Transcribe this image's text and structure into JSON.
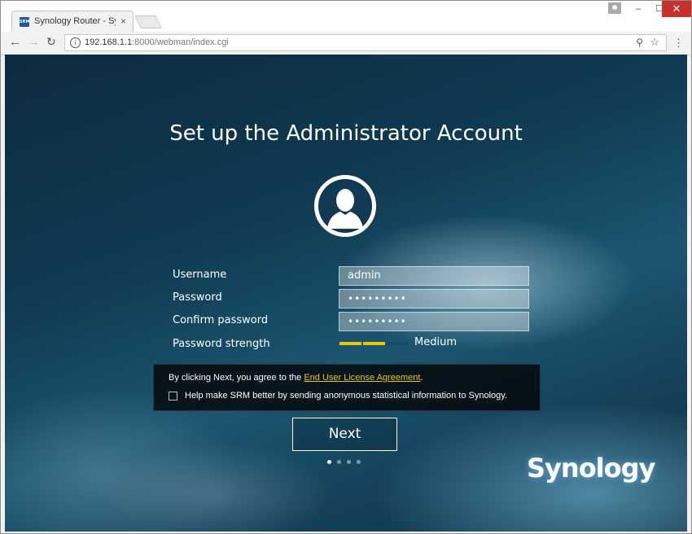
{
  "browser": {
    "tab_title": "Synology Router - Synology",
    "tab_favicon_text": "SRM",
    "tab_close": "×",
    "url_host": "192.168.1.1",
    "url_rest": ":8000/webman/index.cgi",
    "icons": {
      "back": "arrow-left",
      "forward": "arrow-right",
      "reload": "reload",
      "info": "info",
      "key": "key",
      "star": "star",
      "menu": "vertical-dots",
      "user": "user",
      "minimize": "minimize",
      "maximize": "maximize",
      "close": "close"
    }
  },
  "page": {
    "title": "Set up the Administrator Account",
    "form": {
      "username_label": "Username",
      "username_value": "admin",
      "password_label": "Password",
      "password_value": "•••••••••",
      "confirm_label": "Confirm password",
      "confirm_value": "•••••••••",
      "strength_label": "Password strength",
      "strength_value": "Medium",
      "strength_level": 0.67,
      "strength_color": "#e6c800"
    },
    "agreement": {
      "prefix": "By clicking Next, you agree to the ",
      "link": "End User License Agreement",
      "suffix": ".",
      "checkbox_label": "Help make SRM better by sending anonymous statistical information to Synology.",
      "checkbox_checked": false
    },
    "next_label": "Next",
    "steps": {
      "total": 4,
      "current": 1
    },
    "logo": "Synology"
  }
}
